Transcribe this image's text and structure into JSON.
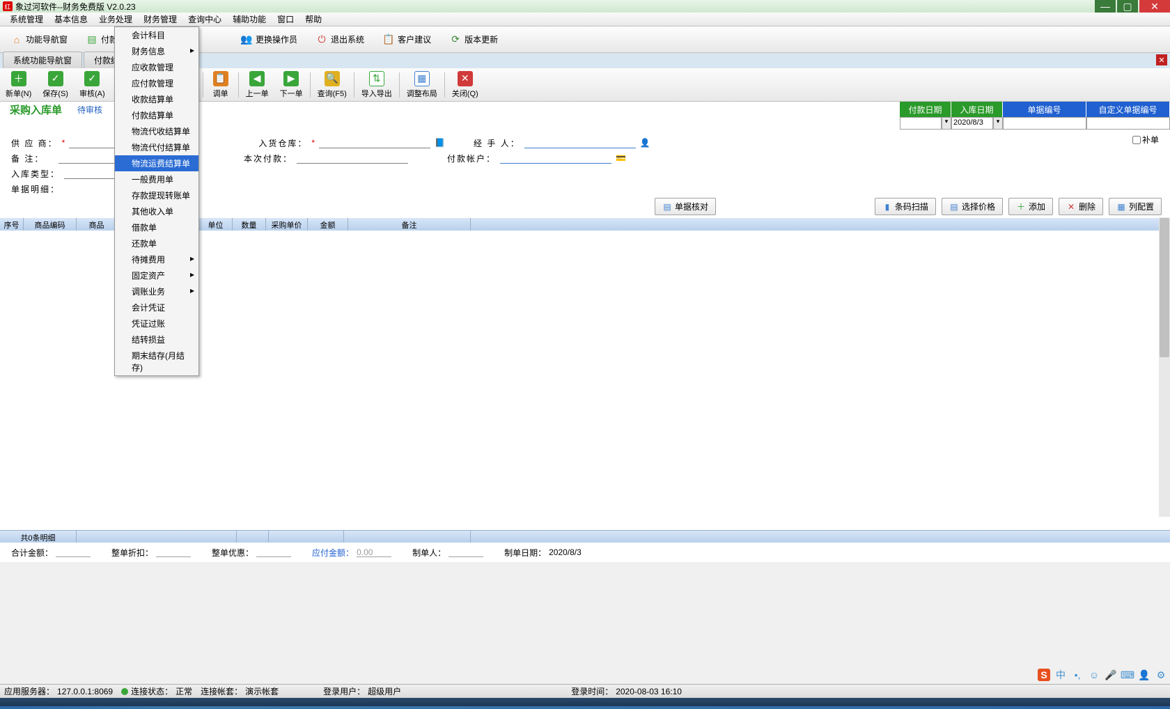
{
  "app_title": "象过河软件--财务免费版 V2.0.23",
  "menus": [
    "系统管理",
    "基本信息",
    "业务处理",
    "财务管理",
    "查询中心",
    "辅助功能",
    "窗口",
    "帮助"
  ],
  "top_tools": [
    {
      "label": "功能导航窗",
      "icon": "🏠",
      "color": "#e08020"
    },
    {
      "label": "付款单",
      "icon": "📄",
      "color": "#3aa63a"
    }
  ],
  "top_tools_right": [
    {
      "label": "更换操作员",
      "icon": "👥"
    },
    {
      "label": "退出系统",
      "icon": "⏻"
    },
    {
      "label": "客户建议",
      "icon": "📋"
    },
    {
      "label": "版本更新",
      "icon": "🔄"
    }
  ],
  "tabs": [
    "系统功能导航窗",
    "付款结算单"
  ],
  "dropdown_items": [
    {
      "label": "会计科目",
      "sub": false
    },
    {
      "label": "财务信息",
      "sub": true
    },
    {
      "label": "应收款管理",
      "sub": false
    },
    {
      "label": "应付款管理",
      "sub": false
    },
    {
      "label": "收款结算单",
      "sub": false
    },
    {
      "label": "付款结算单",
      "sub": false
    },
    {
      "label": "物流代收结算单",
      "sub": false
    },
    {
      "label": "物流代付结算单",
      "sub": false
    },
    {
      "label": "物流运费结算单",
      "sub": false,
      "hl": true
    },
    {
      "label": "一般费用单",
      "sub": false
    },
    {
      "label": "存款提现转账单",
      "sub": false
    },
    {
      "label": "其他收入单",
      "sub": false
    },
    {
      "label": "借款单",
      "sub": false
    },
    {
      "label": "还款单",
      "sub": false
    },
    {
      "label": "待摊费用",
      "sub": true
    },
    {
      "label": "固定资产",
      "sub": true
    },
    {
      "label": "调账业务",
      "sub": true
    },
    {
      "label": "会计凭证",
      "sub": false
    },
    {
      "label": "凭证过账",
      "sub": false
    },
    {
      "label": "结转损益",
      "sub": false
    },
    {
      "label": "期末结存(月结存)",
      "sub": false
    }
  ],
  "toolbar2": [
    {
      "label": "新单(N)",
      "icon": "＋",
      "cls": "green"
    },
    {
      "label": "保存(S)",
      "icon": "✓",
      "cls": "green"
    },
    {
      "label": "审核(A)",
      "icon": "✓",
      "cls": "green",
      "sep": true
    },
    {
      "label": "调单",
      "icon": "📋",
      "cls": "orange"
    },
    {
      "label": "上一单",
      "icon": "◀",
      "cls": "green"
    },
    {
      "label": "下一单",
      "icon": "▶",
      "cls": "green"
    },
    {
      "label": "查询(F5)",
      "icon": "🔍",
      "cls": "yellow",
      "sep": true
    },
    {
      "label": "导入导出",
      "icon": "📤",
      "cls": "green",
      "sep": true
    },
    {
      "label": "调整布局",
      "icon": "▦",
      "cls": "blue2"
    },
    {
      "label": "关闭(Q)",
      "icon": "✕",
      "cls": "red"
    }
  ],
  "form": {
    "title": "采购入库单",
    "status": "待审核",
    "hdr_cols": [
      "付款日期",
      "入库日期",
      "单据编号",
      "自定义单据编号"
    ],
    "date": "2020/8/3",
    "supplier_label": "供 应 商：",
    "remark_label": "备    注：",
    "type_label": "入库类型：",
    "detail_label": "单据明细：",
    "warehouse_label": "入货仓库：",
    "handler_label": "经 手 人：",
    "pay_label": "本次付款：",
    "account_label": "付款帐户：",
    "budan": "补单",
    "star": "*"
  },
  "actions": {
    "check": "单据核对",
    "scan": "条码扫描",
    "price": "选择价格",
    "add": "添加",
    "del": "删除",
    "config": "列配置"
  },
  "columns": [
    "序号",
    "商品编码",
    "商品",
    "单位",
    "数量",
    "采购单价",
    "金额",
    "备注"
  ],
  "summary": "共0条明细",
  "totals": {
    "total": "合计金额：",
    "discount": "整单折扣：",
    "coupon": "整单优惠：",
    "payable": "应付金额：",
    "payable_val": "0.00",
    "maker": "制单人：",
    "date": "制单日期：",
    "date_val": "2020/8/3"
  },
  "status": {
    "server_label": "应用服务器：",
    "server": "127.0.0.1:8069",
    "conn_label": "连接状态：",
    "conn": "正常",
    "book_label": "连接帐套：",
    "book": "演示帐套",
    "user_label": "登录用户：",
    "user": "超级用户",
    "login_label": "登录时间：",
    "login": "2020-08-03 16:10"
  },
  "ime": {
    "sogou": "S",
    "zhong": "中"
  }
}
